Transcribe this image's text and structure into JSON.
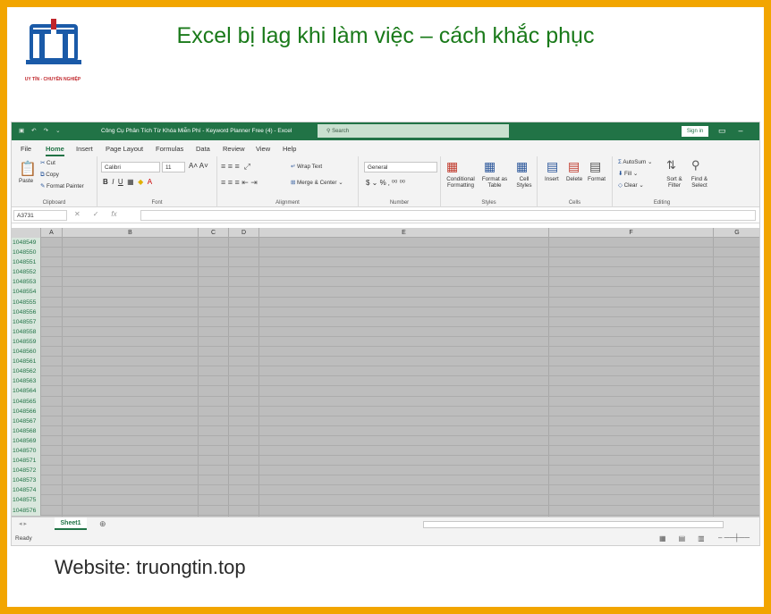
{
  "banner": {
    "logo_text": "UY TÍN - CHUYÊN NGHIỆP",
    "headline": "Excel bị lag khi làm việc – cách khắc phục",
    "website": "Website: truongtin.top"
  },
  "excel": {
    "title": "Công Cụ Phân Tích Từ Khóa Miễn Phí - Keyword Planner Free (4)  -  Excel",
    "search_placeholder": "Search",
    "signin": "Sign in",
    "menu": [
      "File",
      "Home",
      "Insert",
      "Page Layout",
      "Formulas",
      "Data",
      "Review",
      "View",
      "Help"
    ],
    "ribbon": {
      "clipboard": {
        "label": "Clipboard",
        "paste": "Paste",
        "cut": "Cut",
        "copy": "Copy",
        "format_painter": "Format Painter"
      },
      "font": {
        "label": "Font",
        "name": "Calibri",
        "size": "11"
      },
      "alignment": {
        "label": "Alignment",
        "wrap": "Wrap Text",
        "merge": "Merge & Center"
      },
      "number": {
        "label": "Number",
        "format": "General"
      },
      "styles": {
        "label": "Styles",
        "conditional": "Conditional Formatting",
        "format_table": "Format as Table",
        "cell_styles": "Cell Styles"
      },
      "cells": {
        "label": "Cells",
        "insert": "Insert",
        "delete": "Delete",
        "format": "Format"
      },
      "editing": {
        "label": "Editing",
        "autosum": "AutoSum",
        "fill": "Fill",
        "clear": "Clear",
        "sort": "Sort & Filter",
        "find": "Find & Select"
      }
    },
    "name_box": "A3731",
    "columns": [
      "A",
      "B",
      "C",
      "D",
      "E",
      "F",
      "G"
    ],
    "rows": [
      "1048549",
      "1048550",
      "1048551",
      "1048552",
      "1048553",
      "1048554",
      "1048555",
      "1048556",
      "1048557",
      "1048558",
      "1048559",
      "1048560",
      "1048561",
      "1048562",
      "1048563",
      "1048564",
      "1048565",
      "1048566",
      "1048567",
      "1048568",
      "1048569",
      "1048570",
      "1048571",
      "1048572",
      "1048573",
      "1048574",
      "1048575",
      "1048576"
    ],
    "sheet_tab": "Sheet1",
    "status": "Ready"
  },
  "colors": {
    "frame": "#f2a500",
    "excel_green": "#217346",
    "headline": "#1a7a1a",
    "logo_blue": "#1a5aa8",
    "logo_red": "#c0262b"
  }
}
